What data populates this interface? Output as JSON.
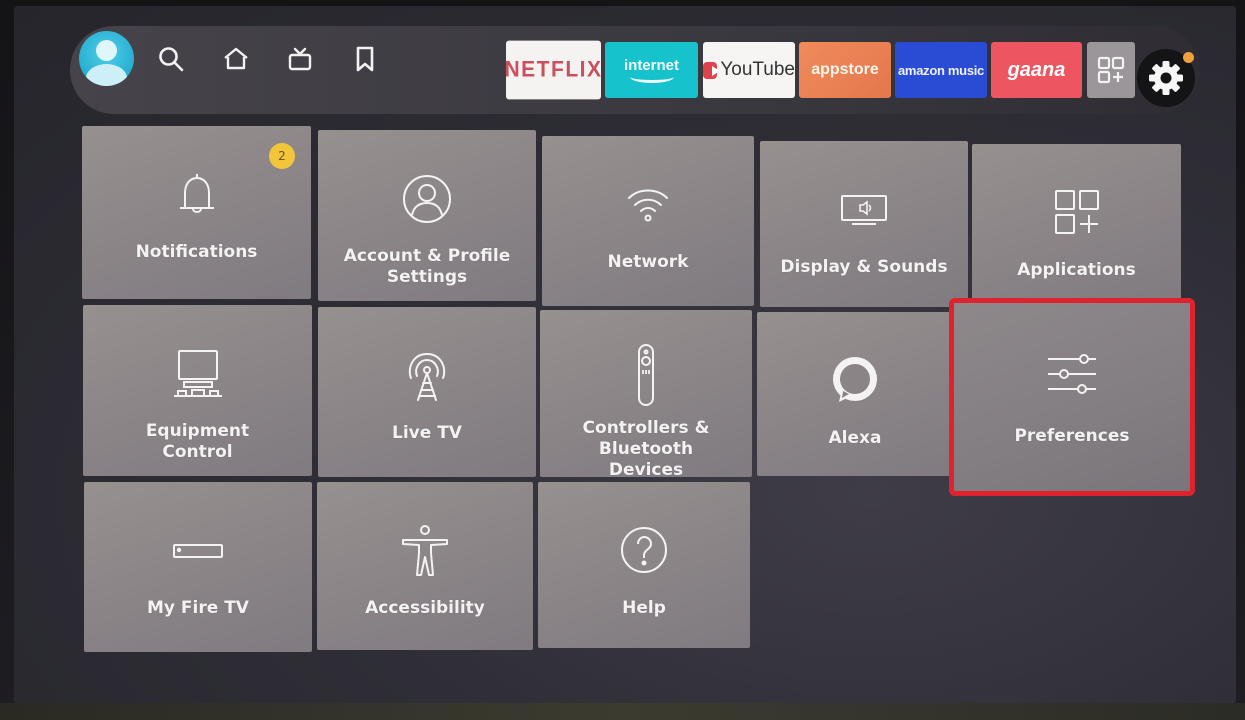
{
  "top_nav": {
    "profile": {
      "icon": "profile-avatar"
    },
    "icons": [
      {
        "name": "search",
        "icon": "search-icon"
      },
      {
        "name": "home",
        "icon": "home-icon"
      },
      {
        "name": "live",
        "icon": "tv-icon"
      },
      {
        "name": "watchlist",
        "icon": "bookmark-icon"
      }
    ],
    "apps": [
      {
        "label": "NETFLIX"
      },
      {
        "label": "internet"
      },
      {
        "label": "YouTube"
      },
      {
        "label": "appstore"
      },
      {
        "label": "amazon music"
      },
      {
        "label": "gaana"
      }
    ],
    "all_apps": {
      "icon": "apps-grid-plus-icon"
    },
    "settings": {
      "icon": "gear-icon",
      "has_notification_dot": true,
      "dot_color": "#f0a13a"
    }
  },
  "settings_grid": {
    "selected": "Preferences",
    "highlight_color": "#e0222f",
    "tiles": [
      {
        "label_line1": "Notifications",
        "label_line2": "",
        "icon": "bell-icon",
        "badge": "2"
      },
      {
        "label_line1": "Account & Profile",
        "label_line2": "Settings",
        "icon": "account-icon"
      },
      {
        "label_line1": "Network",
        "label_line2": "",
        "icon": "wifi-icon"
      },
      {
        "label_line1": "Display & Sounds",
        "label_line2": "",
        "icon": "display-sound-icon"
      },
      {
        "label_line1": "Applications",
        "label_line2": "",
        "icon": "apps-icon"
      },
      {
        "label_line1": "Equipment",
        "label_line2": "Control",
        "icon": "equipment-icon"
      },
      {
        "label_line1": "Live TV",
        "label_line2": "",
        "icon": "antenna-icon"
      },
      {
        "label_line1": "Controllers & Bluetooth",
        "label_line2": "Devices",
        "icon": "remote-icon"
      },
      {
        "label_line1": "Alexa",
        "label_line2": "",
        "icon": "alexa-icon"
      },
      {
        "label_line1": "Preferences",
        "label_line2": "",
        "icon": "sliders-icon"
      },
      {
        "label_line1": "My Fire TV",
        "label_line2": "",
        "icon": "firetv-device-icon"
      },
      {
        "label_line1": "Accessibility",
        "label_line2": "",
        "icon": "accessibility-icon"
      },
      {
        "label_line1": "Help",
        "label_line2": "",
        "icon": "help-icon"
      }
    ]
  }
}
